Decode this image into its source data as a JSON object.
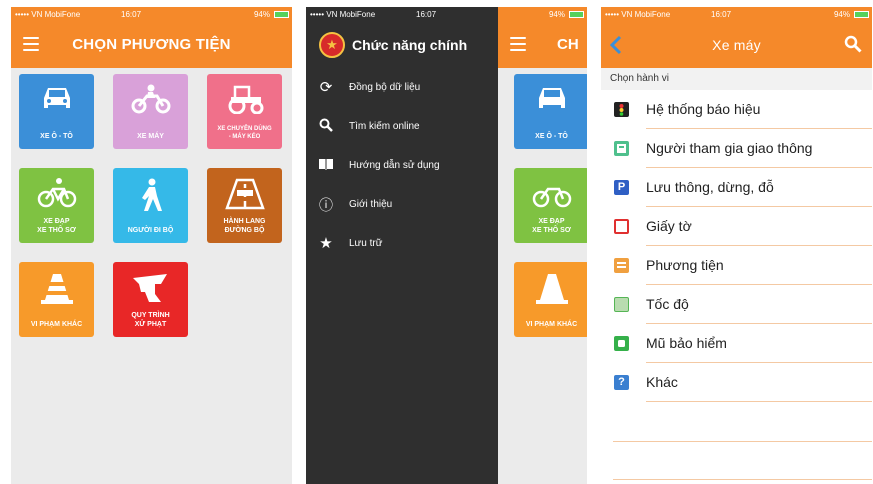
{
  "status": {
    "carrier": "••••• VN MobiFone",
    "time": "16:07",
    "battery": "94%"
  },
  "screen1": {
    "title": "CHỌN PHƯƠNG TIỆN",
    "tiles": [
      {
        "label": "XE Ô - TÔ",
        "color": "#3b8fd8",
        "icon": "car-icon"
      },
      {
        "label": "XE MÁY",
        "color": "#d9a1d9",
        "icon": "motorbike-icon"
      },
      {
        "label": "XE CHUYÊN DÙNG\n- MÁY KÉO",
        "color": "#f0708a",
        "icon": "tractor-icon"
      },
      {
        "label": "XE ĐẠP\nXE THÔ SƠ",
        "color": "#7fc242",
        "icon": "bicycle-icon"
      },
      {
        "label": "NGƯỜI ĐI BỘ",
        "color": "#35b9e8",
        "icon": "pedestrian-icon"
      },
      {
        "label": "HÀNH LANG\nĐƯỜNG BỘ",
        "color": "#c2641d",
        "icon": "road-icon"
      },
      {
        "label": "VI PHẠM KHÁC",
        "color": "#f79a2a",
        "icon": "cone-icon"
      },
      {
        "label": "QUY TRÌNH\nXỬ PHẠT",
        "color": "#e82727",
        "icon": "officer-icon"
      }
    ]
  },
  "screen2": {
    "drawer_title": "Chức năng chính",
    "menu": [
      {
        "label": "Đồng bộ dữ liệu",
        "icon": "sync-icon"
      },
      {
        "label": "Tìm kiếm online",
        "icon": "search-icon"
      },
      {
        "label": "Hướng dẫn sử dụng",
        "icon": "book-icon"
      },
      {
        "label": "Giới thiệu",
        "icon": "info-icon"
      },
      {
        "label": "Lưu trữ",
        "icon": "star-icon"
      }
    ],
    "peek_title": "CH",
    "peek_tiles": [
      "XE Ô - TÔ",
      "XE ĐẠP\nXE THÔ SƠ",
      "VI PHẠM KHÁC"
    ]
  },
  "screen3": {
    "title": "Xe máy",
    "section": "Chọn hành vi",
    "items": [
      {
        "label": "Hệ thống báo hiệu",
        "icon": "traffic-light-icon",
        "color": "#222222"
      },
      {
        "label": "Người tham gia giao thông",
        "icon": "person-icon",
        "color": "#4fc08d"
      },
      {
        "label": "Lưu thông, dừng, đỗ",
        "icon": "parking-icon",
        "color": "#2f5fc4"
      },
      {
        "label": "Giấy tờ",
        "icon": "document-icon",
        "color": "#e03030"
      },
      {
        "label": "Phương tiện",
        "icon": "vehicle-icon",
        "color": "#f0a040"
      },
      {
        "label": "Tốc độ",
        "icon": "speed-icon",
        "color": "#55b555"
      },
      {
        "label": "Mũ bảo hiểm",
        "icon": "helmet-icon",
        "color": "#35b04a"
      },
      {
        "label": "Khác",
        "icon": "question-icon",
        "color": "#3a7fd0"
      }
    ]
  }
}
